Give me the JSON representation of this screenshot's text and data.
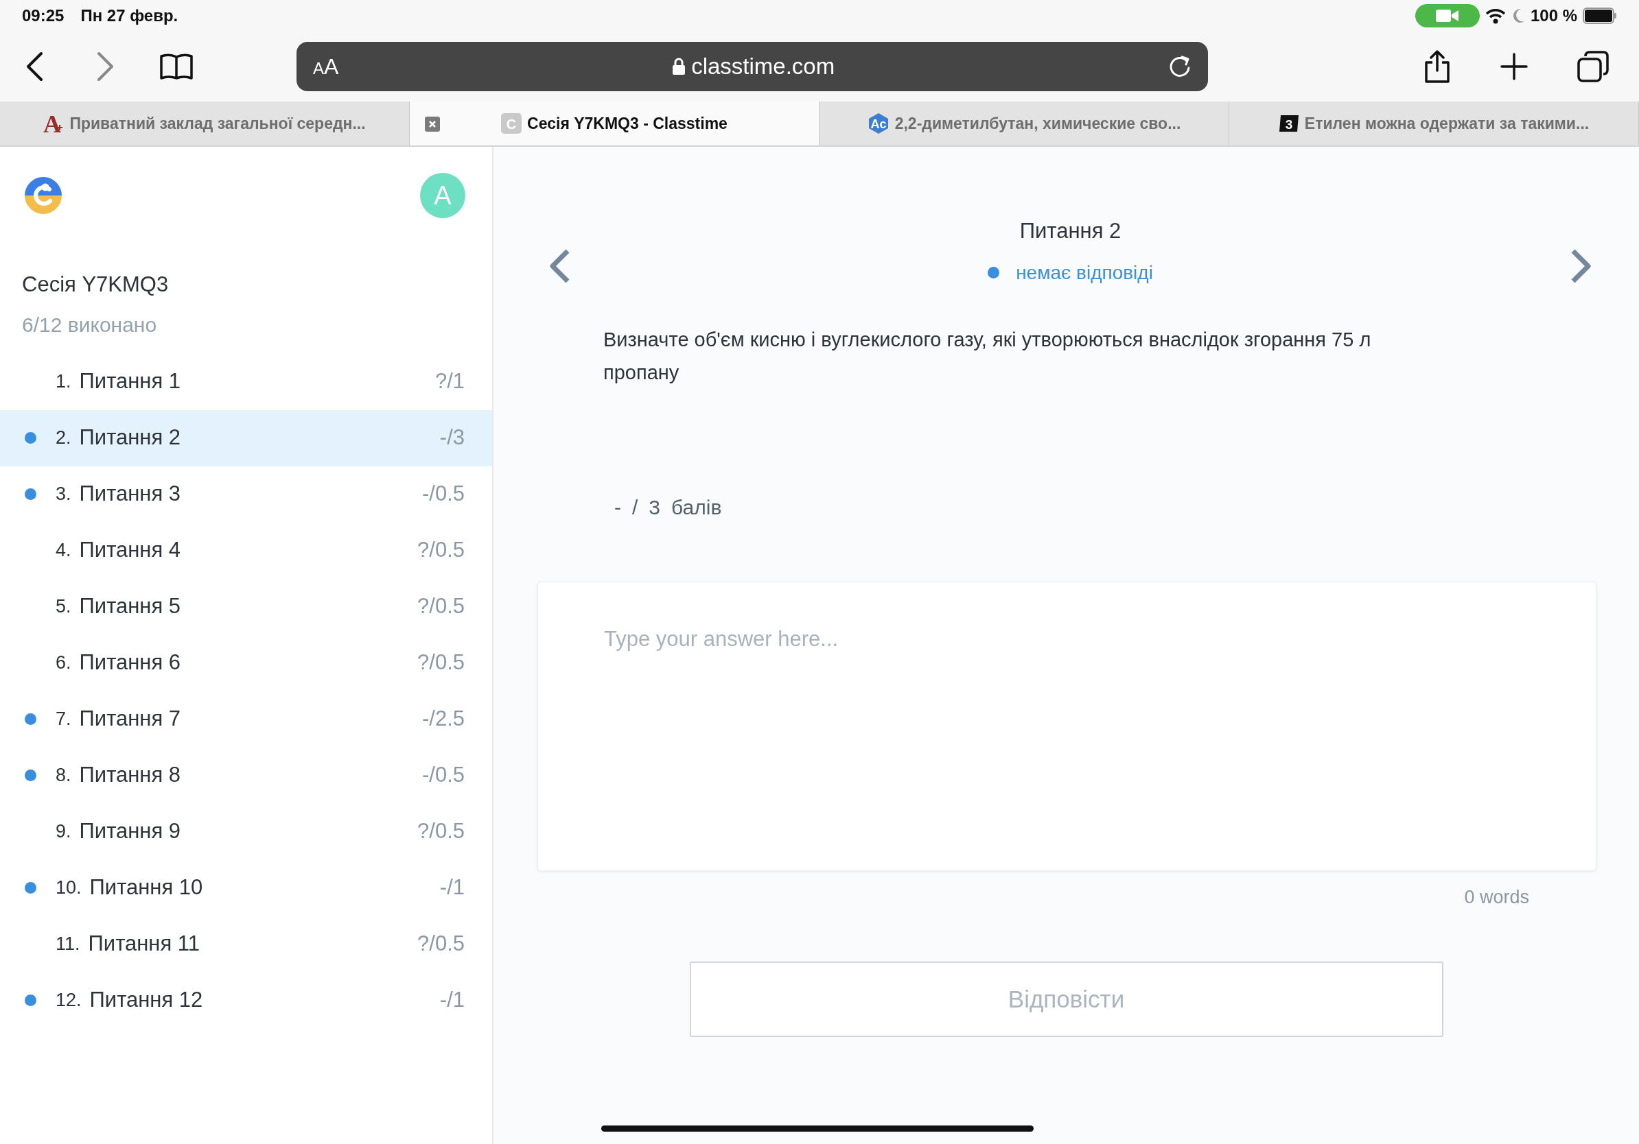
{
  "status_bar": {
    "time": "09:25",
    "date": "Пн 27 февр.",
    "battery": "100 %"
  },
  "toolbar": {
    "format_button": "AA",
    "url": "classtime.com"
  },
  "tabs": [
    {
      "title": "Приватний заклад загальної середн...",
      "favicon": {
        "kind": "serif",
        "text": "A"
      },
      "selected": false
    },
    {
      "title": "Сесія Y7KMQ3 - Classtime",
      "favicon": {
        "kind": "grey",
        "text": "C"
      },
      "selected": true
    },
    {
      "title": "2,2-диметилбутан, химические сво...",
      "favicon": {
        "kind": "hex",
        "text": "Ac"
      },
      "selected": false
    },
    {
      "title": "Етилен можна одержати за такими...",
      "favicon": {
        "kind": "black",
        "text": "3"
      },
      "selected": false
    }
  ],
  "sidebar": {
    "avatar": "A",
    "session_title": "Сесія Y7KMQ3",
    "progress": "6/12 виконано",
    "questions": [
      {
        "number": "1.",
        "title": "Питання 1",
        "score": "?/1",
        "marked": false,
        "selected": false
      },
      {
        "number": "2.",
        "title": "Питання 2",
        "score": "-/3",
        "marked": true,
        "selected": true
      },
      {
        "number": "3.",
        "title": "Питання 3",
        "score": "-/0.5",
        "marked": true,
        "selected": false
      },
      {
        "number": "4.",
        "title": "Питання 4",
        "score": "?/0.5",
        "marked": false,
        "selected": false
      },
      {
        "number": "5.",
        "title": "Питання 5",
        "score": "?/0.5",
        "marked": false,
        "selected": false
      },
      {
        "number": "6.",
        "title": "Питання 6",
        "score": "?/0.5",
        "marked": false,
        "selected": false
      },
      {
        "number": "7.",
        "title": "Питання 7",
        "score": "-/2.5",
        "marked": true,
        "selected": false
      },
      {
        "number": "8.",
        "title": "Питання 8",
        "score": "-/0.5",
        "marked": true,
        "selected": false
      },
      {
        "number": "9.",
        "title": "Питання 9",
        "score": "?/0.5",
        "marked": false,
        "selected": false
      },
      {
        "number": "10.",
        "title": "Питання 10",
        "score": "-/1",
        "marked": true,
        "selected": false
      },
      {
        "number": "11.",
        "title": "Питання 11",
        "score": "?/0.5",
        "marked": false,
        "selected": false
      },
      {
        "number": "12.",
        "title": "Питання 12",
        "score": "-/1",
        "marked": true,
        "selected": false
      }
    ]
  },
  "main": {
    "title": "Питання 2",
    "status": "немає відповіді",
    "question": "Визначте об'єм кисню і вуглекислого газу, які утворюються внаслідок згорання 75 л пропану",
    "points": [
      "-",
      "/",
      "3",
      "балів"
    ],
    "answer": {
      "placeholder": "Type your answer here..."
    },
    "word_count": "0 words",
    "submit": {
      "label": "Відповісти",
      "disabled": true
    }
  }
}
